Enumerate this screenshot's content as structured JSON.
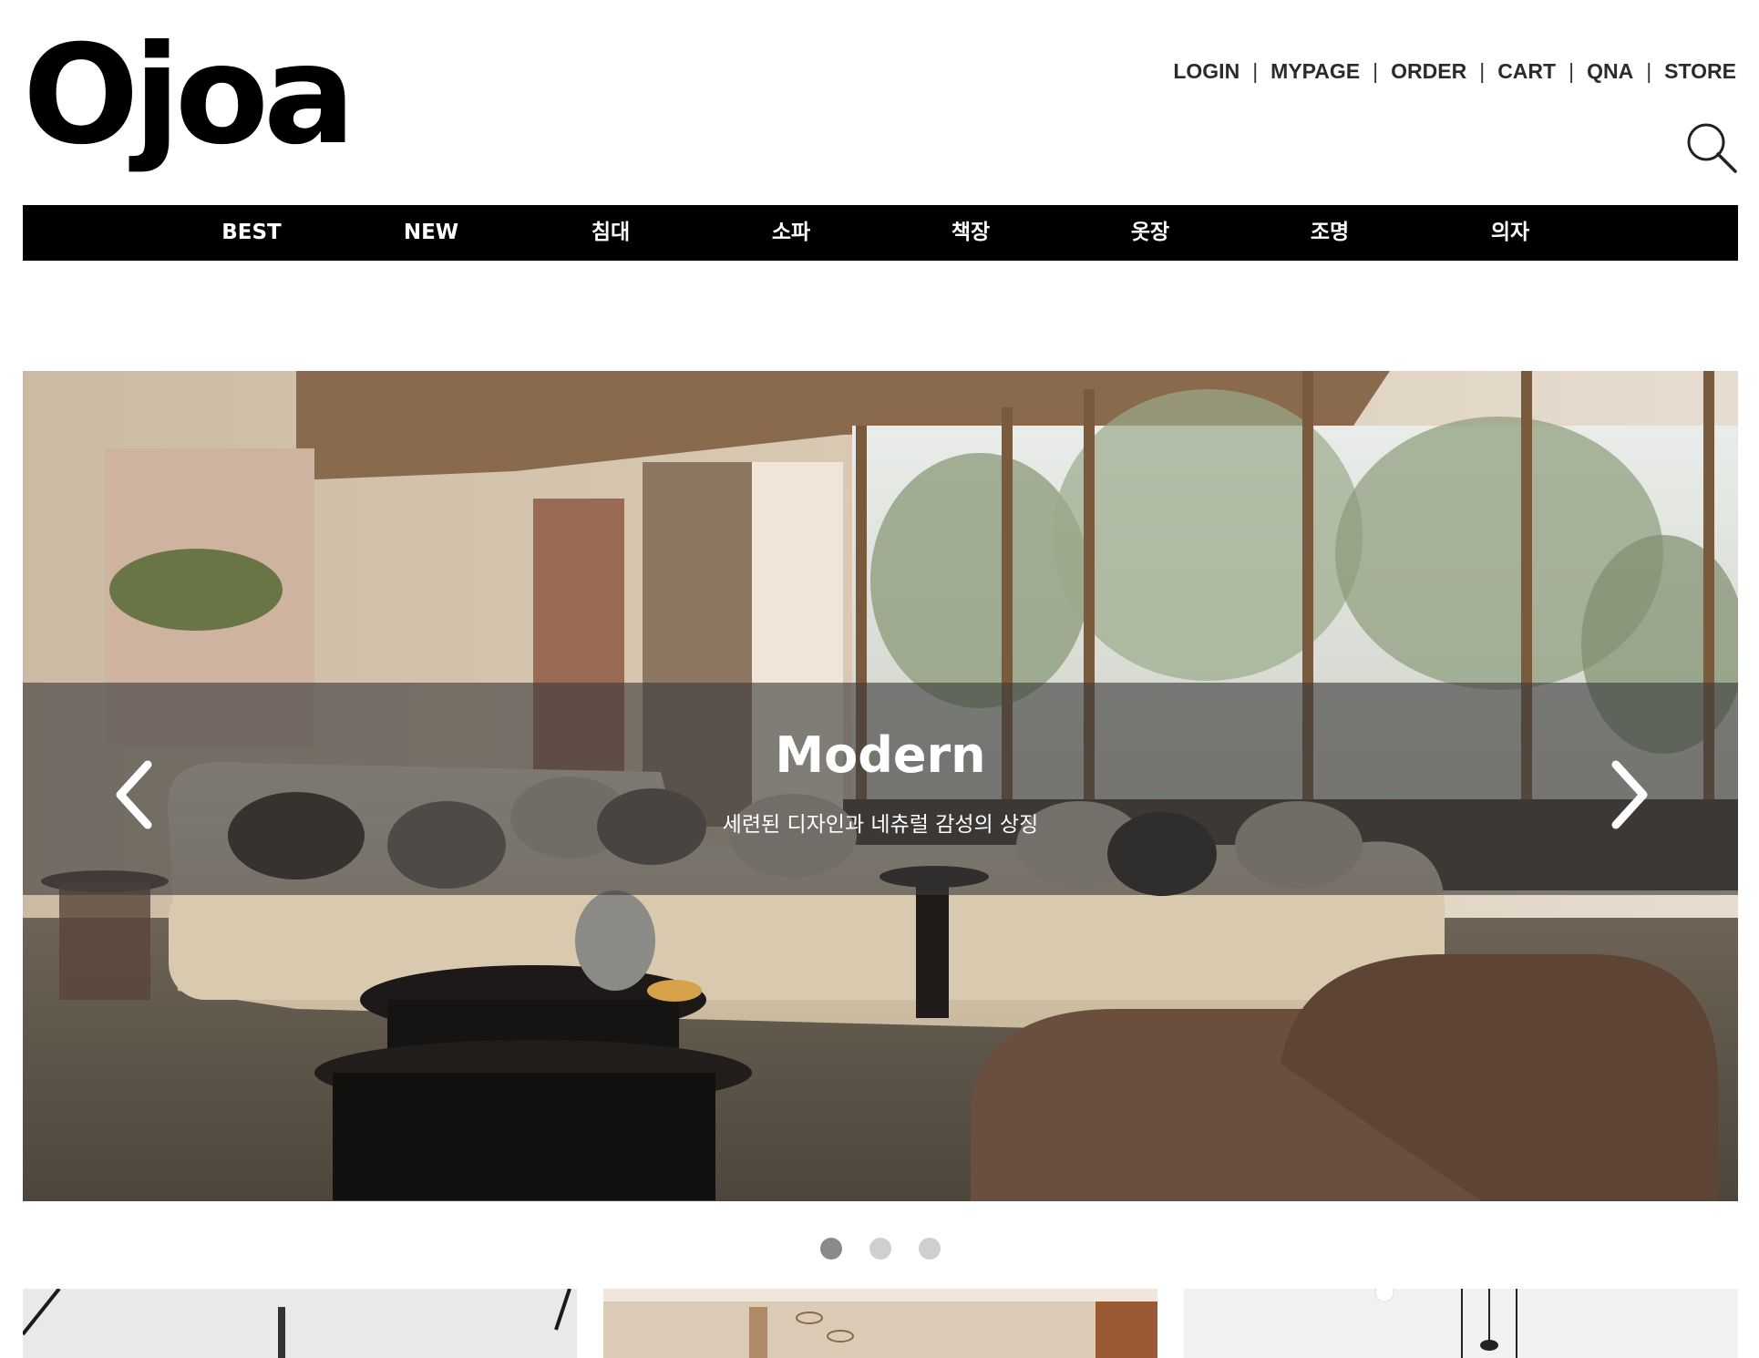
{
  "brand": {
    "logo_text": "Ojoa"
  },
  "util_nav": [
    "LOGIN",
    "MYPAGE",
    "ORDER",
    "CART",
    "QNA",
    "STORE"
  ],
  "gnb": [
    "BEST",
    "NEW",
    "침대",
    "소파",
    "책장",
    "옷장",
    "조명",
    "의자"
  ],
  "hero": {
    "title": "Modern",
    "subtitle": "세련된 디자인과 네츄럴 감성의 상징",
    "active_slide": 1,
    "slide_count": 3
  },
  "colors": {
    "nav_bg": "#000000",
    "text": "#2b2b2b",
    "dot_active": "#8a8a8a",
    "dot_inactive": "#cfcfcf"
  },
  "icons": [
    "search-icon",
    "chevron-left-icon",
    "chevron-right-icon"
  ]
}
